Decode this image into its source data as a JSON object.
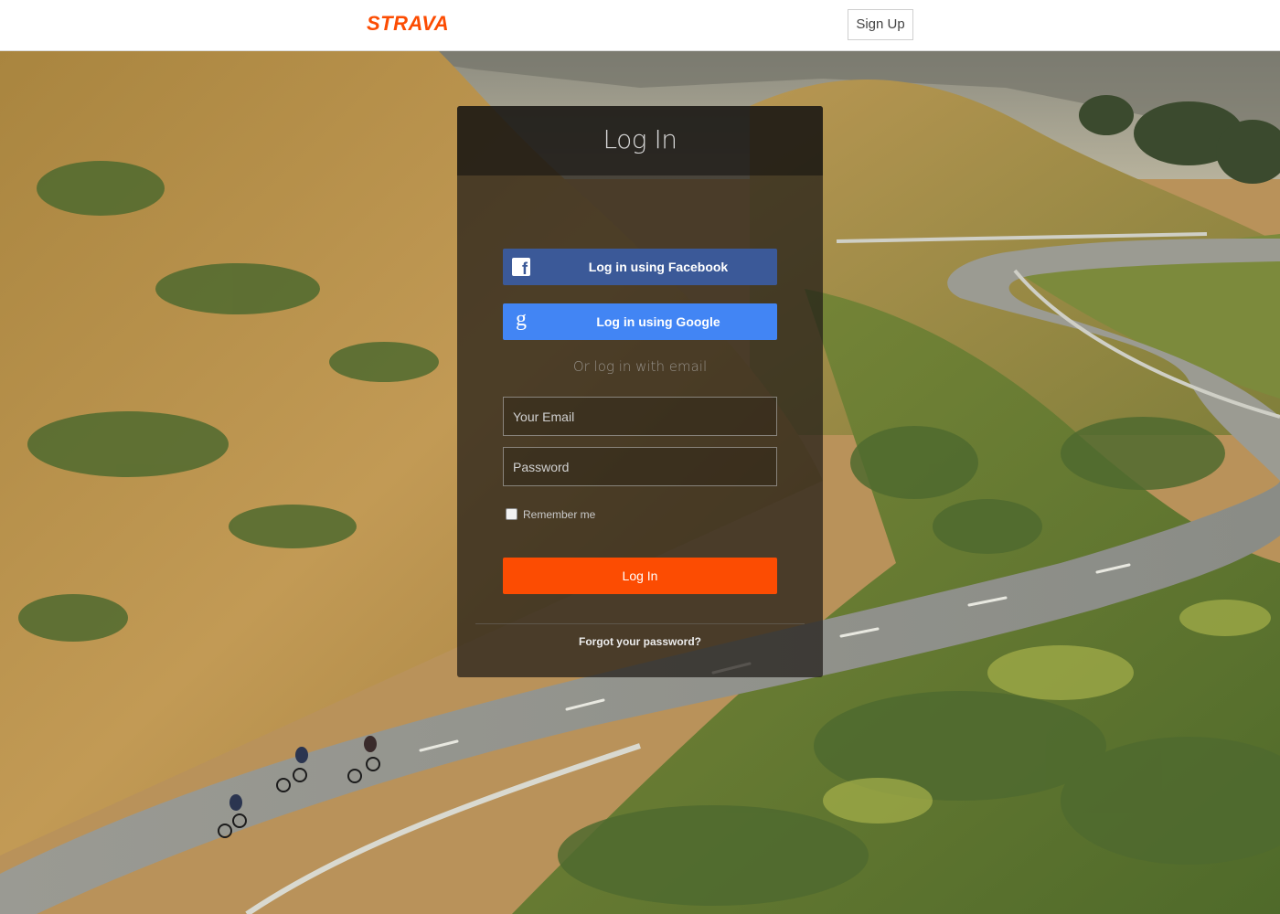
{
  "header": {
    "logo_text": "STRAVA",
    "signup_label": "Sign Up"
  },
  "login": {
    "title": "Log In",
    "facebook_label": "Log in using Facebook",
    "google_label": "Log in using Google",
    "or_text": "Or log in with email",
    "email_placeholder": "Your Email",
    "password_placeholder": "Password",
    "remember_label": "Remember me",
    "submit_label": "Log In",
    "forgot_label": "Forgot your password?"
  },
  "icons": {
    "facebook": "facebook-icon",
    "google": "google-icon"
  },
  "colors": {
    "brand": "#fc4c02",
    "facebook": "#3b5998",
    "google": "#4285f4"
  }
}
